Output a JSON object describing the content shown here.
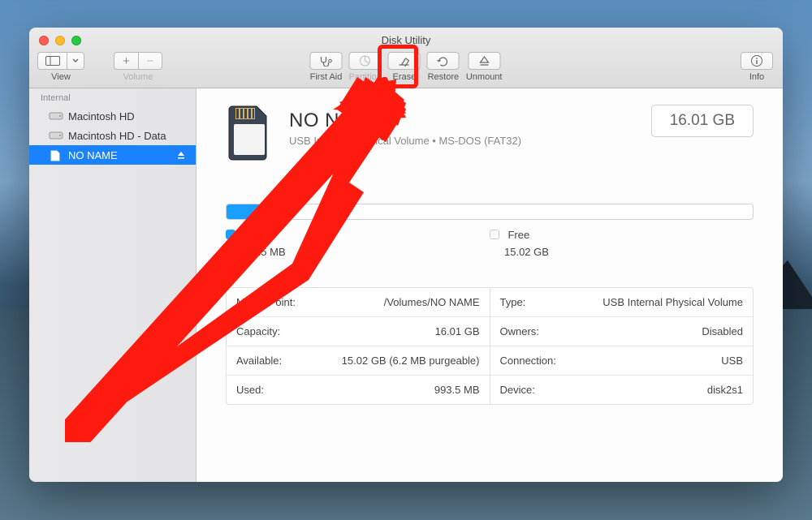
{
  "window": {
    "title": "Disk Utility"
  },
  "toolbar": {
    "view": "View",
    "volume": "Volume",
    "first_aid": "First Aid",
    "partition": "Partition",
    "erase": "Erase",
    "restore": "Restore",
    "unmount": "Unmount",
    "info": "Info"
  },
  "sidebar": {
    "heading": "Internal",
    "items": [
      {
        "label": "Macintosh HD",
        "selected": false
      },
      {
        "label": "Macintosh HD - Data",
        "selected": false
      },
      {
        "label": "NO NAME",
        "selected": true,
        "ejectable": true
      }
    ]
  },
  "volume": {
    "name": "NO NAME",
    "subtitle": "USB Internal Physical Volume • MS-DOS (FAT32)",
    "total_size": "16.01 GB",
    "legend": {
      "used_label": "Used",
      "used_value": "993.5 MB",
      "used_color": "#1a9fff",
      "free_label": "Free",
      "free_value": "15.02 GB",
      "free_color": "#ffffff"
    },
    "details_left": [
      {
        "key": "Mount Point:",
        "value": "/Volumes/NO NAME"
      },
      {
        "key": "Capacity:",
        "value": "16.01 GB"
      },
      {
        "key": "Available:",
        "value": "15.02 GB (6.2 MB purgeable)"
      },
      {
        "key": "Used:",
        "value": "993.5 MB"
      }
    ],
    "details_right": [
      {
        "key": "Type:",
        "value": "USB Internal Physical Volume"
      },
      {
        "key": "Owners:",
        "value": "Disabled"
      },
      {
        "key": "Connection:",
        "value": "USB"
      },
      {
        "key": "Device:",
        "value": "disk2s1"
      }
    ]
  },
  "annotation": {
    "highlight_target": "erase-button"
  }
}
